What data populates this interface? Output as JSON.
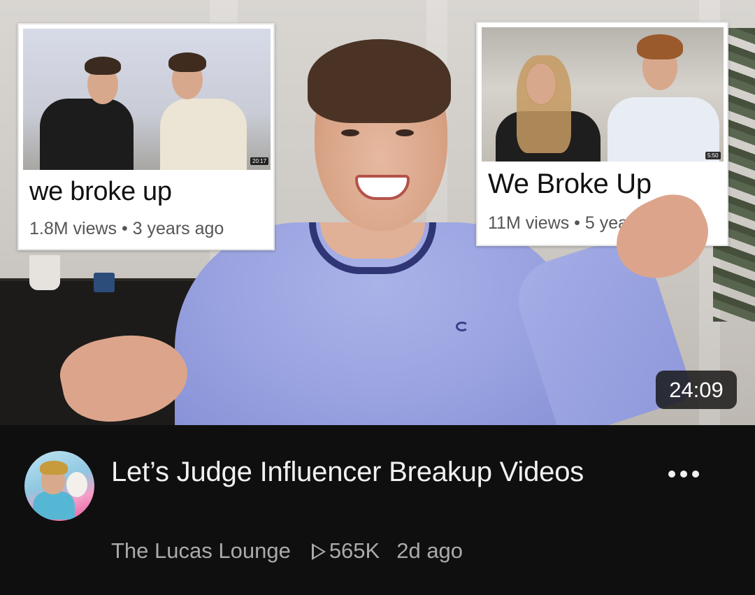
{
  "video": {
    "duration": "24:09",
    "title": "Let’s Judge Influencer Breakup Videos",
    "channel": "The Lucas Lounge",
    "views": "565K",
    "age": "2d ago"
  },
  "thumbnail_cards": [
    {
      "title": "we broke up",
      "meta": "1.8M views • 3 years ago",
      "duration": "20:17"
    },
    {
      "title": "We Broke Up",
      "meta": "11M views • 5 years ago",
      "duration": "5:50"
    }
  ],
  "icons": {
    "more": "more-vertical-dots-icon",
    "views": "play-icon",
    "avatar": "channel-avatar"
  },
  "colors": {
    "background": "#0f0f0f",
    "title_text": "#f1f1f1",
    "meta_text": "#aaaaaa",
    "sweater": "#9aa3e0"
  }
}
